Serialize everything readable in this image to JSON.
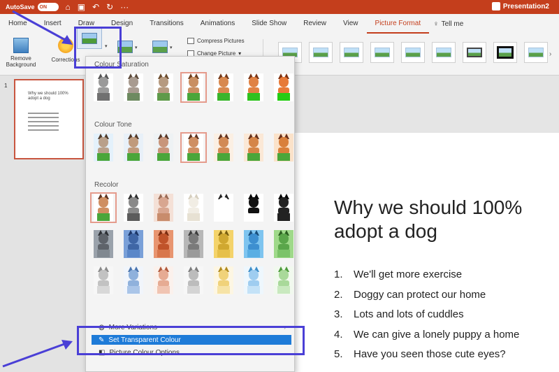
{
  "titlebar": {
    "autosave_label": "AutoSave",
    "autosave_state": "ON",
    "doc_title": "Presentation2"
  },
  "tabs": [
    "Home",
    "Insert",
    "Draw",
    "Design",
    "Transitions",
    "Animations",
    "Slide Show",
    "Review",
    "View",
    "Picture Format"
  ],
  "active_tab": "Picture Format",
  "tell_me": "Tell me",
  "ribbon": {
    "remove_background": "Remove Background",
    "corrections": "Corrections",
    "compress_pictures": "Compress Pictures",
    "change_picture": "Change Picture"
  },
  "slide_panel": {
    "slide_number": "1",
    "thumb_title": "Why we should 100% adopt a dog"
  },
  "color_menu": {
    "sections": {
      "saturation": "Colour Saturation",
      "tone": "Colour Tone",
      "recolor": "Recolor"
    },
    "more_variations": "More Variations",
    "set_transparent": "Set Transparent Colour",
    "picture_options": "Picture Colour Options..."
  },
  "slide": {
    "title": "Why we should 100% adopt a dog",
    "bullets": [
      {
        "num": "1.",
        "text": "We'll get more exercise"
      },
      {
        "num": "2.",
        "text": "Doggy can protect our home"
      },
      {
        "num": "3.",
        "text": "Lots and lots of cuddles"
      },
      {
        "num": "4.",
        "text": "We can give a lonely puppy a home"
      },
      {
        "num": "5.",
        "text": "Have you seen those cute eyes?"
      }
    ]
  },
  "colors": {
    "accent": "#c43e1c",
    "highlight": "#1e7bd8",
    "annotation": "#4a3fd6"
  }
}
